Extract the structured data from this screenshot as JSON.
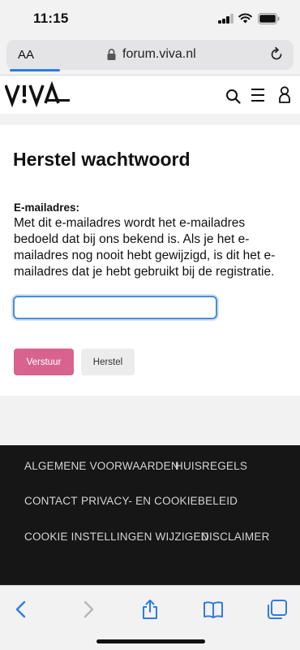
{
  "status_bar": {
    "time": "11:15"
  },
  "browser": {
    "text_size_label": "AA",
    "url": "forum.viva.nl"
  },
  "site": {
    "logo": "VIVA"
  },
  "form": {
    "title": "Herstel wachtwoord",
    "email_label": "E-mailadres:",
    "email_help": "Met dit e-mailadres wordt het e-mailadres bedoeld dat bij ons bekend is. Als je het e-mailadres nog nooit hebt gewijzigd, is dit het e-mailadres dat je hebt gebruikt bij de registratie.",
    "email_value": "",
    "send_label": "Verstuur",
    "reset_label": "Herstel"
  },
  "footer": {
    "links": [
      "ALGEMENE VOORWAARDEN",
      "HUISREGELS",
      "CONTACT",
      "PRIVACY- EN COOKIEBELEID",
      "COOKIE INSTELLINGEN WIJZIGEN",
      "DISCLAIMER"
    ]
  },
  "colors": {
    "accent": "#d7638e",
    "footer_bg": "#161616",
    "ios_blue": "#2f7be6"
  },
  "icons": [
    "signal-icon",
    "wifi-icon",
    "battery-icon",
    "lock-icon",
    "reload-icon",
    "search-icon",
    "menu-icon",
    "user-icon",
    "back-icon",
    "forward-icon",
    "share-icon",
    "bookmarks-icon",
    "tabs-icon"
  ]
}
